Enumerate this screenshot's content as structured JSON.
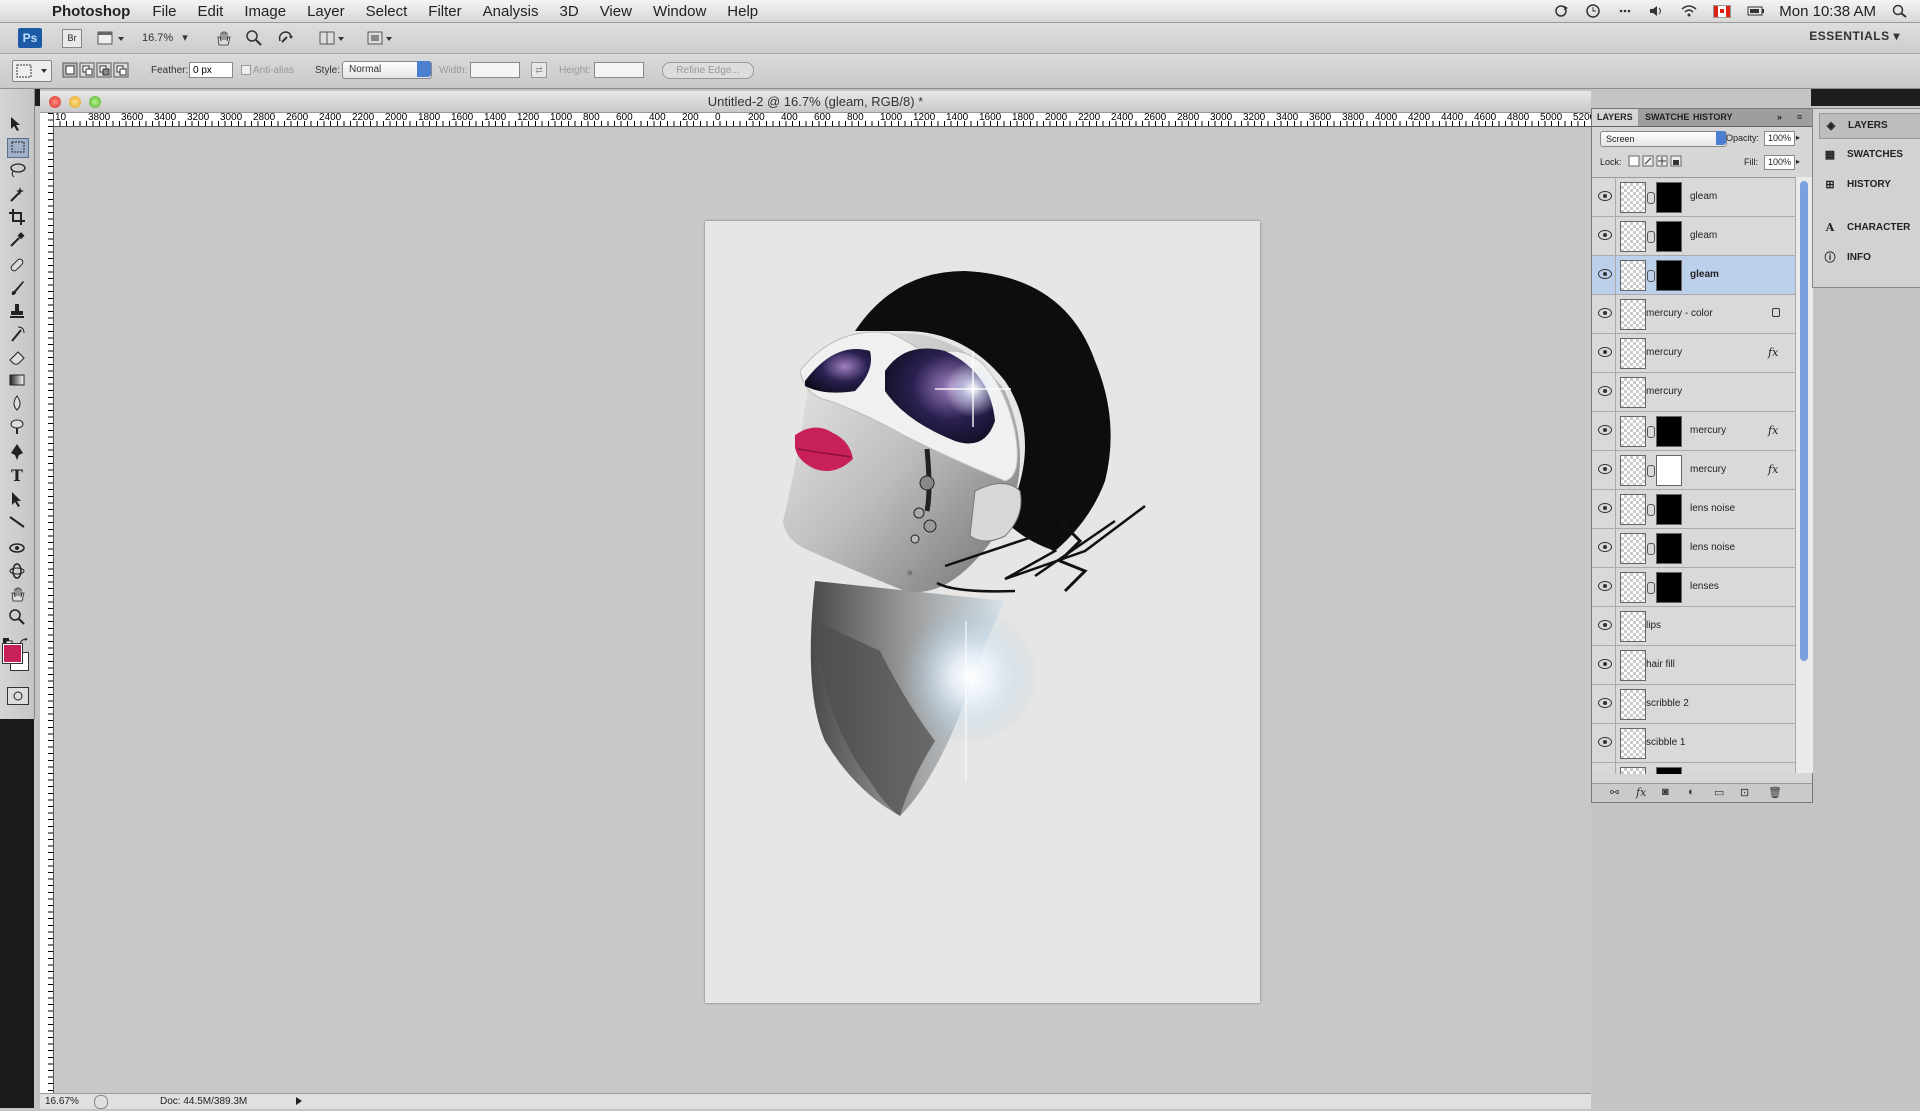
{
  "menubar": {
    "app": "Photoshop",
    "menus": [
      "File",
      "Edit",
      "Image",
      "Layer",
      "Select",
      "Filter",
      "Analysis",
      "3D",
      "View",
      "Window",
      "Help"
    ],
    "clock": "Mon 10:38 AM"
  },
  "appbar": {
    "ps": "Ps",
    "br": "Br",
    "zoom": "16.7%",
    "workspace": "ESSENTIALS"
  },
  "options": {
    "feather_label": "Feather:",
    "feather_value": "0 px",
    "antialias_label": "Anti-alias",
    "style_label": "Style:",
    "style_value": "Normal",
    "width_label": "Width:",
    "height_label": "Height:",
    "refine_label": "Refine Edge..."
  },
  "document": {
    "title": "Untitled-2 @ 16.7% (gleam, RGB/8) *",
    "zoom_status": "16.67%",
    "doc_status": "Doc: 44.5M/389.3M",
    "ruler_labels": [
      "10",
      "3800",
      "3600",
      "3400",
      "3200",
      "3000",
      "2800",
      "2600",
      "2400",
      "2200",
      "2000",
      "1800",
      "1600",
      "1400",
      "1200",
      "1000",
      "800",
      "600",
      "400",
      "200",
      "0",
      "200",
      "400",
      "600",
      "800",
      "1000",
      "1200",
      "1400",
      "1600",
      "1800",
      "2000",
      "2200",
      "2400",
      "2600",
      "2800",
      "3000",
      "3200",
      "3400",
      "3600",
      "3800",
      "4000",
      "4200",
      "4400",
      "4600",
      "4800",
      "5000",
      "5200"
    ]
  },
  "layers_panel": {
    "tabs": [
      "LAYERS",
      "SWATCHES",
      "HISTORY"
    ],
    "blend_mode": "Screen",
    "opacity_label": "Opacity:",
    "opacity": "100%",
    "lock_label": "Lock:",
    "fill_label": "Fill:",
    "fill": "100%",
    "layers": [
      {
        "name": "gleam",
        "mask": "dark",
        "selected": false
      },
      {
        "name": "gleam",
        "mask": "dark",
        "selected": false
      },
      {
        "name": "gleam",
        "mask": "dark",
        "selected": true
      },
      {
        "name": "mercury - color",
        "mask": "",
        "selected": false,
        "locked": true
      },
      {
        "name": "mercury",
        "mask": "",
        "selected": false,
        "fx": true
      },
      {
        "name": "mercury",
        "mask": "",
        "selected": false
      },
      {
        "name": "mercury",
        "mask": "dark",
        "selected": false,
        "fx": true
      },
      {
        "name": "mercury",
        "mask": "white",
        "selected": false,
        "fx": true
      },
      {
        "name": "lens noise",
        "mask": "dark",
        "selected": false
      },
      {
        "name": "lens noise",
        "mask": "dark",
        "selected": false
      },
      {
        "name": "lenses",
        "mask": "dark",
        "selected": false
      },
      {
        "name": "lips",
        "mask": "",
        "selected": false
      },
      {
        "name": "hair fill",
        "mask": "",
        "selected": false
      },
      {
        "name": "scribble 2",
        "mask": "",
        "selected": false
      },
      {
        "name": "scibble 1",
        "mask": "",
        "selected": false
      },
      {
        "name": "",
        "mask": "dark",
        "selected": false
      }
    ]
  },
  "dock": {
    "items": [
      "LAYERS",
      "SWATCHES",
      "HISTORY",
      "CHARACTER",
      "INFO"
    ]
  },
  "colors": {
    "foreground": "#c8215a",
    "background": "#ffffff",
    "accent": "#4b7fd1"
  }
}
